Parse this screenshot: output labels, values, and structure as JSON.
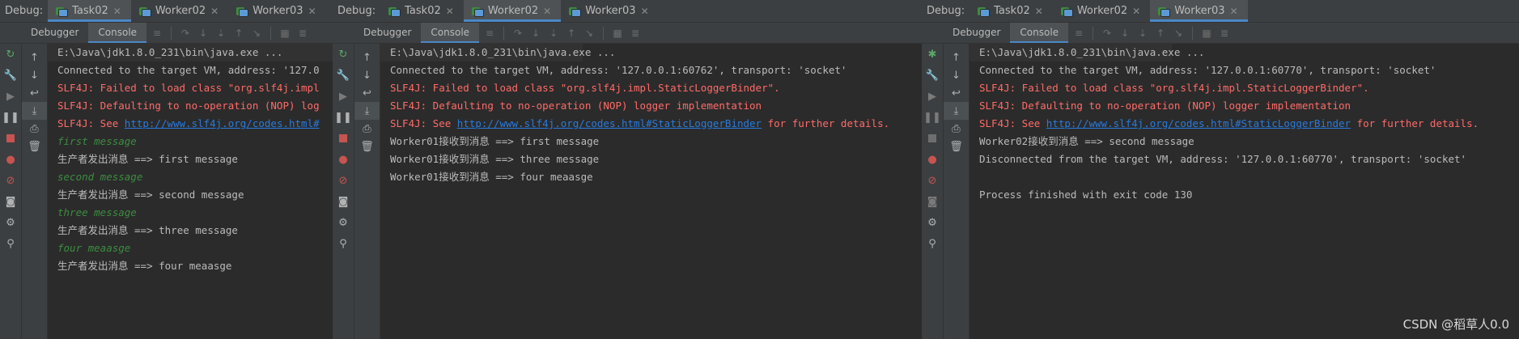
{
  "debug_label": "Debug:",
  "tabs": [
    "Task02",
    "Worker02",
    "Worker03"
  ],
  "subtabs": {
    "debugger": "Debugger",
    "console": "Console"
  },
  "panels": [
    {
      "lines": [
        {
          "t": "E:\\Java\\jdk1.8.0_231\\bin\\java.exe ...",
          "c": "cmd"
        },
        {
          "t": "Connected to the target VM, address: '127.0",
          "c": "normal"
        },
        {
          "t": "SLF4J: Failed to load class \"org.slf4j.impl",
          "c": "err"
        },
        {
          "t": "SLF4J: Defaulting to no-operation (NOP) log",
          "c": "err"
        },
        {
          "t": "SLF4J: See ",
          "link": "http://www.slf4j.org/codes.html#",
          "tail": "",
          "c": "err"
        },
        {
          "t": "first message",
          "c": "green"
        },
        {
          "t": "生产者发出消息 ==> first message",
          "c": "normal"
        },
        {
          "t": "second message",
          "c": "green"
        },
        {
          "t": "生产者发出消息 ==> second message",
          "c": "normal"
        },
        {
          "t": "three message",
          "c": "green"
        },
        {
          "t": "生产者发出消息 ==> three message",
          "c": "normal"
        },
        {
          "t": "four meaasge",
          "c": "green"
        },
        {
          "t": "生产者发出消息 ==> four meaasge",
          "c": "normal"
        }
      ]
    },
    {
      "lines": [
        {
          "t": "E:\\Java\\jdk1.8.0_231\\bin\\java.exe ...",
          "c": "cmd"
        },
        {
          "t": "Connected to the target VM, address: '127.0.0.1:60762', transport: 'socket'",
          "c": "normal"
        },
        {
          "t": "SLF4J: Failed to load class \"org.slf4j.impl.StaticLoggerBinder\".",
          "c": "err"
        },
        {
          "t": "SLF4J: Defaulting to no-operation (NOP) logger implementation",
          "c": "err"
        },
        {
          "t": "SLF4J: See ",
          "link": "http://www.slf4j.org/codes.html#StaticLoggerBinder",
          "tail": " for further details.",
          "c": "err"
        },
        {
          "t": "Worker01接收到消息 ==> first message",
          "c": "normal"
        },
        {
          "t": "Worker01接收到消息 ==> three message",
          "c": "normal"
        },
        {
          "t": "Worker01接收到消息 ==> four meaasge",
          "c": "normal"
        }
      ]
    },
    {
      "lines": [
        {
          "t": "E:\\Java\\jdk1.8.0_231\\bin\\java.exe ...",
          "c": "cmd"
        },
        {
          "t": "Connected to the target VM, address: '127.0.0.1:60770', transport: 'socket'",
          "c": "normal"
        },
        {
          "t": "SLF4J: Failed to load class \"org.slf4j.impl.StaticLoggerBinder\".",
          "c": "err"
        },
        {
          "t": "SLF4J: Defaulting to no-operation (NOP) logger implementation",
          "c": "err"
        },
        {
          "t": "SLF4J: See ",
          "link": "http://www.slf4j.org/codes.html#StaticLoggerBinder",
          "tail": " for further details.",
          "c": "err"
        },
        {
          "t": "Worker02接收到消息 ==> second message",
          "c": "normal"
        },
        {
          "t": "Disconnected from the target VM, address: '127.0.0.1:60770', transport: 'socket'",
          "c": "normal"
        },
        {
          "t": "",
          "c": "normal"
        },
        {
          "t": "Process finished with exit code 130",
          "c": "normal"
        }
      ]
    }
  ],
  "watermark": "CSDN @稻草人0.0",
  "colors": {
    "error": "#ff6b68",
    "link": "#287bde",
    "green": "#3d8c40",
    "accent": "#4a88c7"
  }
}
